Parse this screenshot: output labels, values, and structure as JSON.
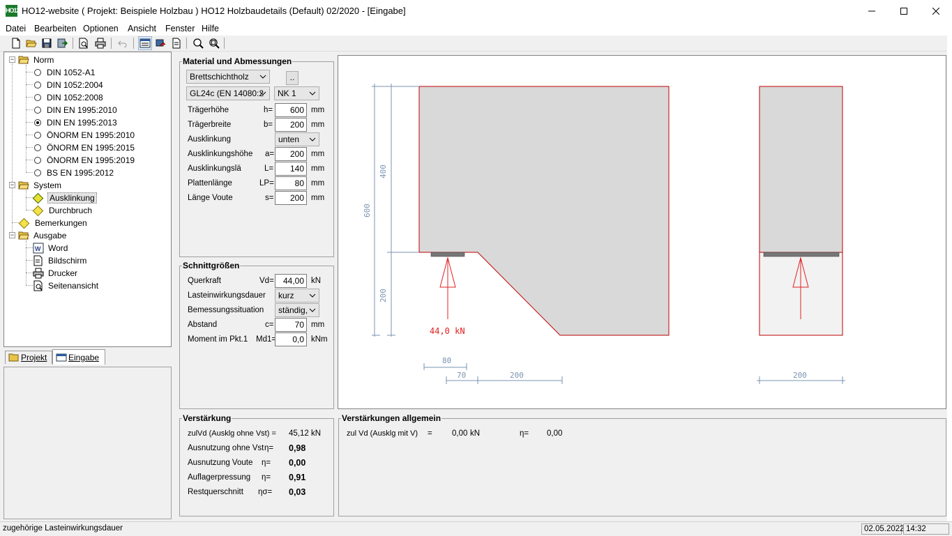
{
  "window": {
    "icon_text": "HO12",
    "title": "HO12-website ( Projekt: Beispiele Holzbau ) HO12 Holzbaudetails (Default) 02/2020  - [Eingabe]"
  },
  "menu": [
    "Datei",
    "Bearbeiten",
    "Optionen",
    "Ansicht",
    "Fenster",
    "Hilfe"
  ],
  "tree": {
    "norm": "Norm",
    "norm_items": [
      "DIN 1052-A1",
      "DIN 1052:2004",
      "DIN 1052:2008",
      "DIN EN 1995:2010",
      "DIN EN 1995:2013",
      "ÖNORM EN 1995:2010",
      "ÖNORM EN 1995:2015",
      "ÖNORM EN 1995:2019",
      "BS EN 1995:2012"
    ],
    "selected_norm": "DIN EN 1995:2013",
    "system": "System",
    "system_items": [
      "Ausklinkung",
      "Durchbruch"
    ],
    "bemerkungen": "Bemerkungen",
    "ausgabe": "Ausgabe",
    "ausgabe_items": [
      "Word",
      "Bildschirm",
      "Drucker",
      "Seitenansicht"
    ]
  },
  "tabs": {
    "projekt": "Projekt",
    "eingabe": "Eingabe"
  },
  "material": {
    "title": "Material und Abmessungen",
    "material_type": "Brettschichtholz",
    "more_button": "..",
    "grade": "GL24c (EN 14080:2",
    "nk": "NK 1",
    "rows": [
      {
        "label": "Trägerhöhe",
        "sym": "h=",
        "value": "600",
        "unit": "mm"
      },
      {
        "label": "Trägerbreite",
        "sym": "b=",
        "value": "200",
        "unit": "mm"
      },
      {
        "label": "Ausklinkung",
        "combo": "unten"
      },
      {
        "label": "Ausklinkungshöhe",
        "sym": "a=",
        "value": "200",
        "unit": "mm"
      },
      {
        "label": "Ausklinkungslä",
        "sym": "L=",
        "value": "140",
        "unit": "mm"
      },
      {
        "label": "Plattenlänge",
        "sym": "LP=",
        "value": "80",
        "unit": "mm"
      },
      {
        "label": "Länge Voute",
        "sym": "s=",
        "value": "200",
        "unit": "mm"
      }
    ]
  },
  "schnitt": {
    "title": "Schnittgrößen",
    "querkraft": {
      "label": "Querkraft",
      "sym": "Vd=",
      "value": "44,00",
      "unit": "kN"
    },
    "lastdauer": {
      "label": "Lasteinwirkungsdauer",
      "combo": "kurz"
    },
    "bemessung": {
      "label": "Bemessungssituation",
      "combo": "ständig,"
    },
    "abstand": {
      "label": "Abstand",
      "sym": "c=",
      "value": "70",
      "unit": "mm"
    },
    "moment": {
      "label": "Moment im Pkt.1",
      "sym": "Md1=",
      "value": "0,0",
      "unit": "kNm"
    }
  },
  "verstaerkung": {
    "title": "Verstärkung",
    "zulvd": {
      "label": "zulVd (Ausklg ohne Vst) =",
      "value": "45,12",
      "unit": "kN"
    },
    "rows": [
      {
        "label": "Ausnutzung ohne Vst",
        "sym": "η=",
        "value": "0,98"
      },
      {
        "label": "Ausnutzung Voute",
        "sym": "η=",
        "value": "0,00"
      },
      {
        "label": "Auflagerpressung",
        "sym": "η=",
        "value": "0,91"
      },
      {
        "label": "Restquerschnitt",
        "sym": "ησ=",
        "value": "0,03"
      }
    ]
  },
  "allgemein": {
    "title": "Verstärkungen allgemein",
    "label": "zul Vd (Ausklg mit V)",
    "eq": "=",
    "value": "0,00",
    "unit": "kN",
    "eta_sym": "η=",
    "eta": "0,00"
  },
  "drawing": {
    "dim_400": "400",
    "dim_600": "600",
    "dim_200_v": "200",
    "load_label": "44,0  kN",
    "dim_80": "80",
    "dim_70": "70",
    "dim_200_h": "200",
    "dim_200_right": "200"
  },
  "status": {
    "hint": "zugehörige Lasteinwirkungsdauer",
    "date": "02.05.2022",
    "time": "14:32"
  },
  "colors": {
    "outline_red": "#c00000",
    "dim_blue": "#7a93b0",
    "beam_fill": "#d9d9d9"
  }
}
